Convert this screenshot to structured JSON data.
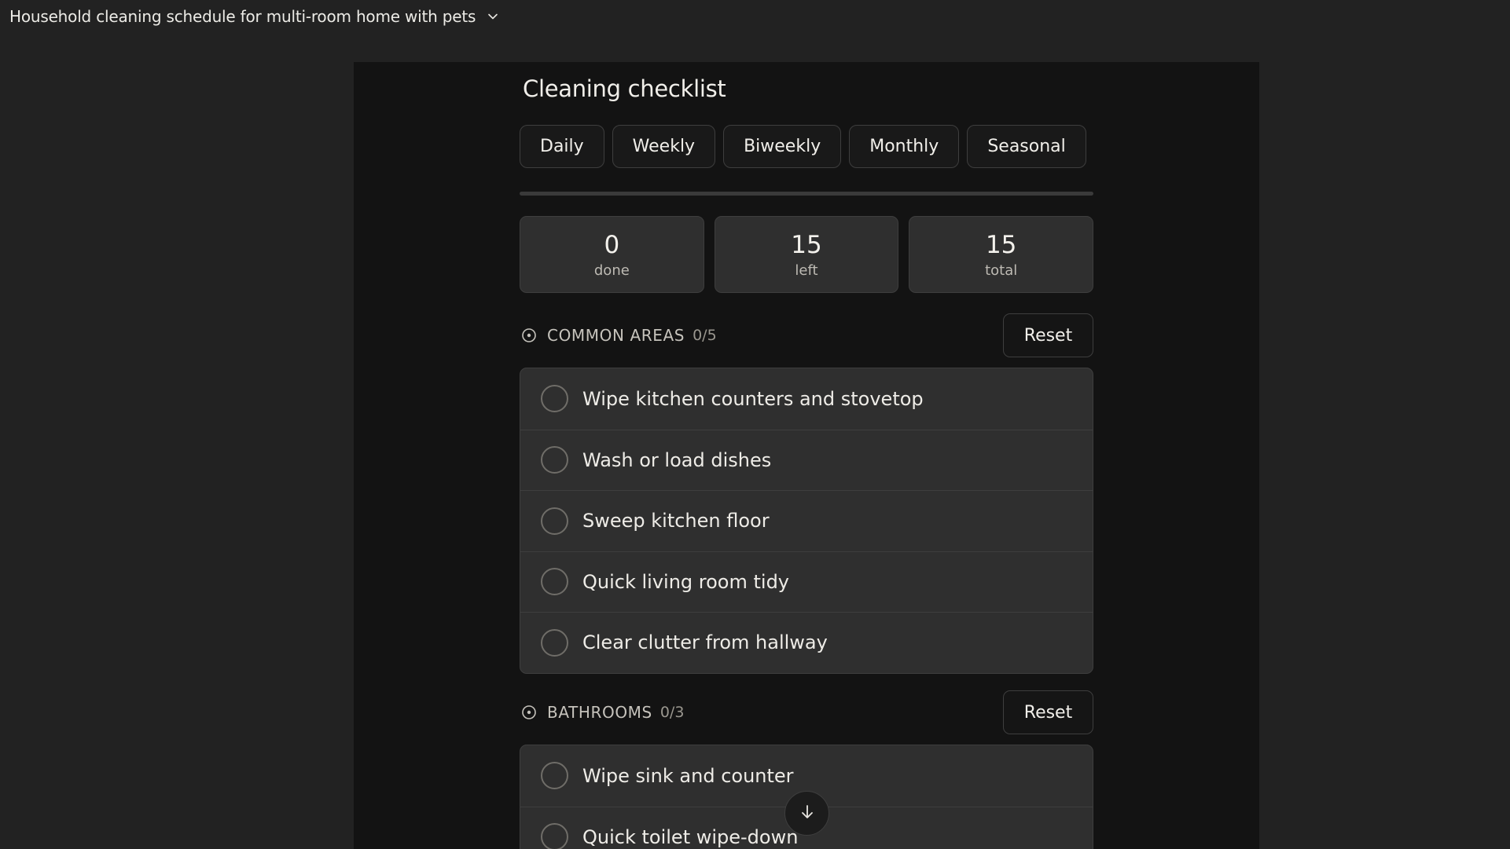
{
  "header": {
    "title": "Household cleaning schedule for multi-room home with pets",
    "chevron_icon": "chevron-down-icon"
  },
  "checklist": {
    "heading": "Cleaning checklist",
    "tabs": [
      {
        "label": "Daily"
      },
      {
        "label": "Weekly"
      },
      {
        "label": "Biweekly"
      },
      {
        "label": "Monthly"
      },
      {
        "label": "Seasonal"
      }
    ],
    "progress": 0,
    "stats": {
      "done": {
        "value": "0",
        "label": "done"
      },
      "left": {
        "value": "15",
        "label": "left"
      },
      "total": {
        "value": "15",
        "label": "total"
      }
    },
    "sections": [
      {
        "name": "COMMON AREAS",
        "count": "0/5",
        "reset_label": "Reset",
        "tasks": [
          {
            "label": "Wipe kitchen counters and stovetop",
            "done": false
          },
          {
            "label": "Wash or load dishes",
            "done": false
          },
          {
            "label": "Sweep kitchen floor",
            "done": false
          },
          {
            "label": "Quick living room tidy",
            "done": false
          },
          {
            "label": "Clear clutter from hallway",
            "done": false
          }
        ]
      },
      {
        "name": "BATHROOMS",
        "count": "0/3",
        "reset_label": "Reset",
        "tasks": [
          {
            "label": "Wipe sink and counter",
            "done": false
          },
          {
            "label": "Quick toilet wipe-down",
            "done": false
          }
        ]
      }
    ]
  },
  "colors": {
    "page_bg": "#222222",
    "artifact_bg": "#131313",
    "card_bg": "#2f2f2f",
    "border": "#3e3e3e",
    "text": "#f1efea",
    "muted": "#bdbab3"
  },
  "scroll_button_icon": "arrow-down-icon"
}
